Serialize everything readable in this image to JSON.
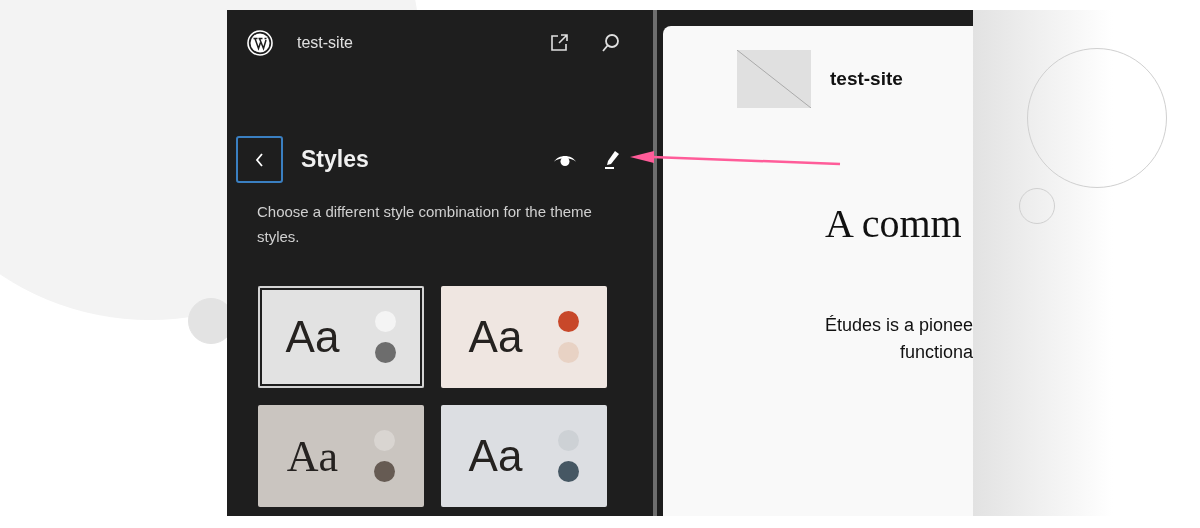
{
  "sidebar": {
    "site_name": "test-site",
    "title": "Styles",
    "description": "Choose a different style combination for the theme styles.",
    "variations": [
      {
        "sample": "Aa",
        "selected": true,
        "kind": "sans",
        "color": "#e2e2e2",
        "swatches": [
          {
            "color": "#f4f4f4"
          },
          {
            "color": "#6d6d6d"
          }
        ]
      },
      {
        "sample": "Aa",
        "selected": false,
        "kind": "sans",
        "color": "#efe6e1",
        "swatches": [
          {
            "color": "#c8482a"
          },
          {
            "color": "#e8d2c4"
          }
        ]
      },
      {
        "sample": "Aa",
        "selected": false,
        "kind": "serif",
        "color": "#cac5c0",
        "swatches": [
          {
            "color": "#d9d5d1"
          },
          {
            "color": "#665b53"
          }
        ]
      },
      {
        "sample": "Aa",
        "selected": false,
        "kind": "sans",
        "color": "#dcdee2",
        "swatches": [
          {
            "color": "#cdd1d5"
          },
          {
            "color": "#465763"
          }
        ]
      }
    ]
  },
  "preview": {
    "site_name": "test-site",
    "heading": "A comm",
    "paragraph_lines": [
      "Études is a pionee",
      "functiona"
    ]
  }
}
